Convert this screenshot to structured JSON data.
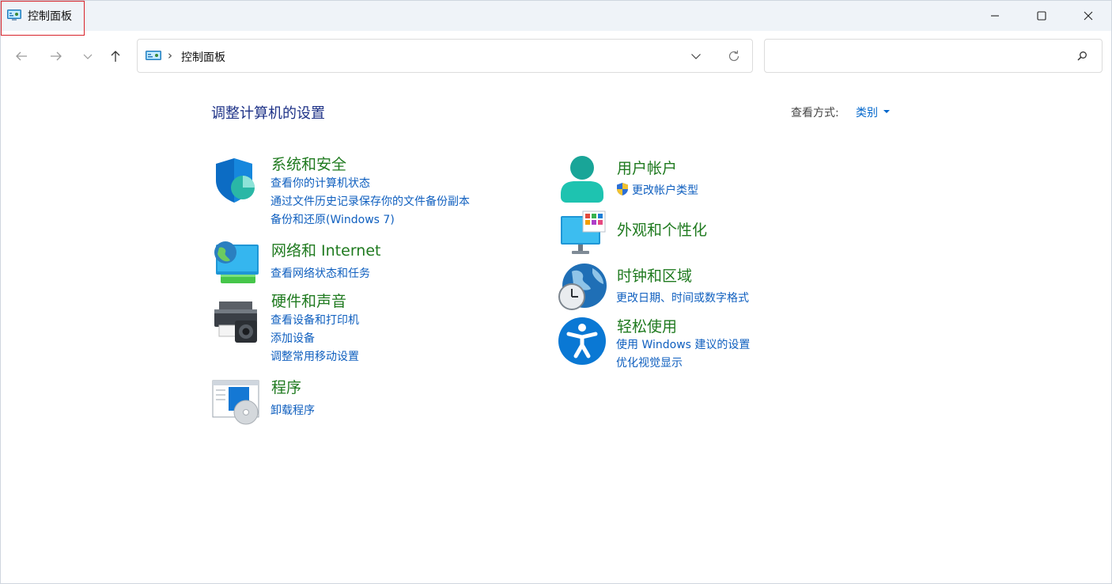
{
  "window": {
    "title": "控制面板",
    "icon": "control-panel-icon"
  },
  "titlebar_buttons": [
    "minimize-icon",
    "maximize-icon",
    "close-icon"
  ],
  "nav": {
    "back_icon": "arrow-left-icon",
    "forward_icon": "arrow-right-icon",
    "recent_icon": "chevron-down-icon",
    "up_icon": "arrow-up-icon"
  },
  "address": {
    "separator": "›",
    "path": "控制面板"
  },
  "search": {
    "value": "",
    "placeholder": ""
  },
  "content": {
    "title": "调整计算机的设置",
    "view_by_label": "查看方式:",
    "view_by_value": "类别"
  },
  "categories_left": [
    {
      "title": "系统和安全",
      "icon": "security-shield-icon",
      "links": [
        "查看你的计算机状态",
        "通过文件历史记录保存你的文件备份副本",
        "备份和还原(Windows 7)"
      ]
    },
    {
      "title": "网络和 Internet",
      "icon": "network-globe-icon",
      "links": [
        "查看网络状态和任务"
      ]
    },
    {
      "title": "硬件和声音",
      "icon": "printer-speaker-icon",
      "links": [
        "查看设备和打印机",
        "添加设备",
        "调整常用移动设置"
      ]
    },
    {
      "title": "程序",
      "icon": "programs-disc-icon",
      "links": [
        "卸载程序"
      ]
    }
  ],
  "categories_right": [
    {
      "title": "用户帐户",
      "icon": "user-account-icon",
      "links": [
        "更改帐户类型"
      ]
    },
    {
      "title": "外观和个性化",
      "icon": "monitor-palette-icon",
      "links": []
    },
    {
      "title": "时钟和区域",
      "icon": "clock-globe-icon",
      "links": [
        "更改日期、时间或数字格式"
      ]
    },
    {
      "title": "轻松使用",
      "icon": "accessibility-icon",
      "links": [
        "使用 Windows 建议的设置",
        "优化视觉显示"
      ]
    }
  ],
  "colors": {
    "title_blue": "#1e3287",
    "category_green": "#1f7a1f",
    "link_blue": "#0f5fbf",
    "titlebar_bg": "#eff3f8",
    "highlight_red": "#d8232a"
  }
}
